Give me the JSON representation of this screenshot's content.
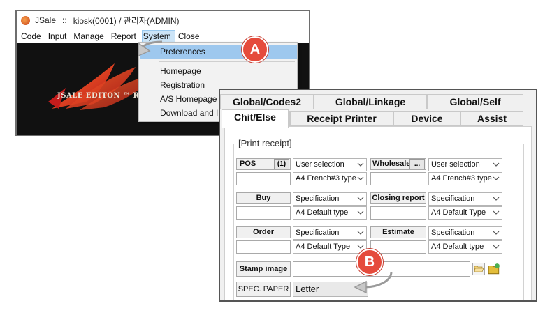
{
  "window1": {
    "title_app": "JSale",
    "title_sep": "::",
    "title_rest": "kiosk(0001) / 관리자(ADMIN)",
    "menu": [
      "Code",
      "Input",
      "Manage",
      "Report",
      "System",
      "Close"
    ],
    "active_menu": "System",
    "logo_text": "JSALE EDITON ™ RE",
    "dropdown": {
      "preferences": "Preferences",
      "homepage": "Homepage",
      "registration": "Registration",
      "as_homepage": "A/S Homepage",
      "download": "Download and Install"
    }
  },
  "window2": {
    "tabs_row1": [
      "Global/Codes2",
      "Global/Linkage",
      "Global/Self"
    ],
    "tabs_row2": [
      "Chit/Else",
      "Receipt Printer",
      "Device",
      "Assist"
    ],
    "selected_tab": "Chit/Else",
    "group_label": "[Print receipt]",
    "pos": {
      "label": "POS",
      "badge": "(1)",
      "sel1": "User selection",
      "sel2": "A4 French#3 type"
    },
    "wholesale": {
      "label": "Wholesale",
      "badge": "...",
      "sel1": "User selection",
      "sel2": "A4 French#3 type"
    },
    "buy": {
      "label": "Buy",
      "sel1": "Specification",
      "sel2": "A4 Default type"
    },
    "closing": {
      "label": "Closing report",
      "sel1": "Specification",
      "sel2": "A4 Default Type"
    },
    "order": {
      "label": "Order",
      "sel1": "Specification",
      "sel2": "A4 Default Type"
    },
    "estimate": {
      "label": "Estimate",
      "sel1": "Specification",
      "sel2": "A4 Default type"
    },
    "stamp_label": "Stamp image",
    "spec_paper_label": "SPEC. PAPER",
    "spec_paper_value": "Letter"
  },
  "callouts": {
    "a": "A",
    "b": "B"
  },
  "colors": {
    "callout": "#e54b3c",
    "highlight": "#9ec8ee",
    "menu_active": "#cce4f7"
  }
}
